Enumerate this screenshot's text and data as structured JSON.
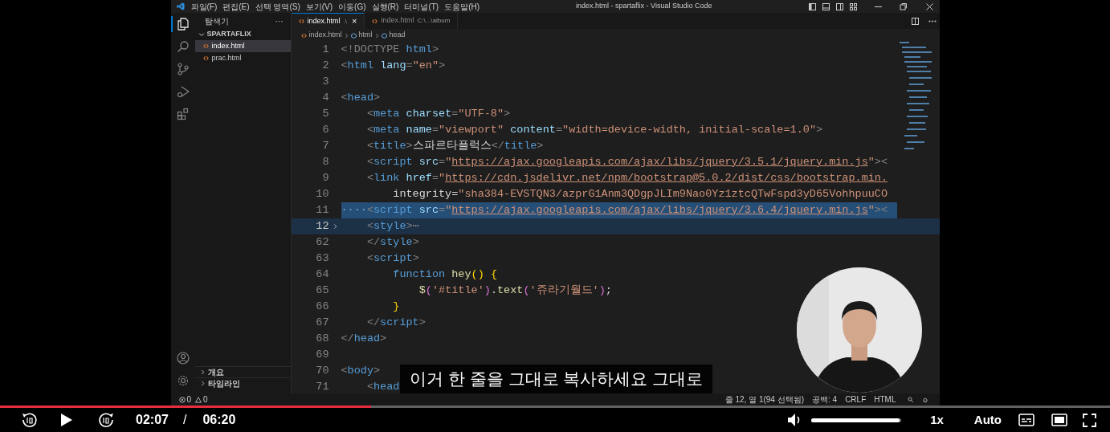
{
  "vscode": {
    "title": "index.html - spartaflix - Visual Studio Code",
    "menu": [
      "파일(F)",
      "편집(E)",
      "선택 영역(S)",
      "보기(V)",
      "이동(G)",
      "실행(R)",
      "터미널(T)",
      "도움말(H)"
    ],
    "activity_bar": [
      {
        "kind": "files",
        "selected": true
      },
      {
        "kind": "search",
        "selected": false
      },
      {
        "kind": "source-control",
        "selected": false
      },
      {
        "kind": "run",
        "selected": false
      },
      {
        "kind": "extensions",
        "selected": false
      }
    ],
    "explorer": {
      "title": "탐색기",
      "more": "···",
      "folder": {
        "name": "SPARTAFLIX",
        "expanded": true,
        "files": [
          {
            "name": "index.html",
            "selected": true
          },
          {
            "name": "prac.html",
            "selected": false
          }
        ]
      },
      "panels": [
        "개요",
        "타임라인"
      ]
    },
    "tabs": [
      {
        "label": "index.html",
        "hint": ".\\",
        "selected": true,
        "close": "×"
      },
      {
        "label": "index.html",
        "hint": "C:\\...\\album",
        "selected": false
      }
    ],
    "breadcrumbs": [
      "index.html",
      "html",
      "head"
    ],
    "lines": [
      {
        "number": "1",
        "selected": false,
        "current": false,
        "folded": false,
        "code": "<!DOCTYPE html>"
      },
      {
        "number": "2",
        "selected": false,
        "current": false,
        "folded": false,
        "code": "<html lang=\"en\">"
      },
      {
        "number": "3",
        "selected": false,
        "current": false,
        "folded": false
      },
      {
        "number": "4",
        "selected": false,
        "current": false,
        "folded": false,
        "code": "<head>"
      },
      {
        "number": "5",
        "selected": false,
        "current": false,
        "folded": false,
        "code": "    <meta charset=\"UTF-8\">"
      },
      {
        "number": "6",
        "selected": false,
        "current": false,
        "folded": false,
        "code": "    <meta name=\"viewport\" content=\"width=device-width, initial-scale=1.0\">"
      },
      {
        "number": "7",
        "selected": false,
        "current": false,
        "folded": false,
        "code": "    <title>스파르타플럭스</title>"
      },
      {
        "number": "8",
        "selected": false,
        "current": false,
        "folded": false,
        "code": "    <script src=\"https://ajax.googleapis.com/ajax/libs/jquery/3.5.1/jquery.min.js\"><"
      },
      {
        "number": "9",
        "selected": false,
        "current": false,
        "folded": false,
        "code": "    <link href=\"https://cdn.jsdelivr.net/npm/bootstrap@5.0.2/dist/css/bootstrap.min."
      },
      {
        "number": "10",
        "selected": false,
        "current": false,
        "folded": false,
        "code": "        integrity=\"sha384-EVSTQN3/azprG1Anm3QDgpJLIm9Nao0Yz1ztcQTwFspd3yD65VohhpuuCO"
      },
      {
        "number": "11",
        "selected": true,
        "current": false,
        "folded": false,
        "code": "····<script src=\"https://ajax.googleapis.com/ajax/libs/jquery/3.6.4/jquery.min.js\"><"
      },
      {
        "number": "12",
        "selected": false,
        "current": true,
        "folded": true,
        "code": "    <style>⋯"
      },
      {
        "number": "62",
        "selected": false,
        "current": false,
        "folded": false,
        "code": "    </style>"
      },
      {
        "number": "63",
        "selected": false,
        "current": false,
        "folded": false,
        "code": "    <script>"
      },
      {
        "number": "64",
        "selected": false,
        "current": false,
        "folded": false,
        "code": "        function hey() {"
      },
      {
        "number": "65",
        "selected": false,
        "current": false,
        "folded": false,
        "code": "            $('#title').text('쥬라기월드');"
      },
      {
        "number": "66",
        "selected": false,
        "current": false,
        "folded": false,
        "code": "        }"
      },
      {
        "number": "67",
        "selected": false,
        "current": false,
        "folded": false,
        "code": "    </script>"
      },
      {
        "number": "68",
        "selected": false,
        "current": false,
        "folded": false,
        "code": "</head>"
      },
      {
        "number": "69",
        "selected": false,
        "current": false,
        "folded": false
      },
      {
        "number": "70",
        "selected": false,
        "current": false,
        "folded": false,
        "code": "<body>"
      },
      {
        "number": "71",
        "selected": false,
        "current": false,
        "folded": false,
        "code": "    <head"
      }
    ],
    "status_bar": {
      "errors": "0",
      "warnings": "0",
      "items": [
        "줄 12, 열 1(94 선택됨)",
        "공백: 4",
        "CRLF",
        "HTML"
      ]
    }
  },
  "player": {
    "progress": {
      "level": 0.334
    },
    "current_time": "02:07",
    "separator": "/",
    "duration": "06:20",
    "volume": {
      "level": 0.98
    },
    "speed": "1x",
    "quality": "Auto",
    "subtitle": "이거 한 줄을 그대로 복사하세요 그대로"
  }
}
